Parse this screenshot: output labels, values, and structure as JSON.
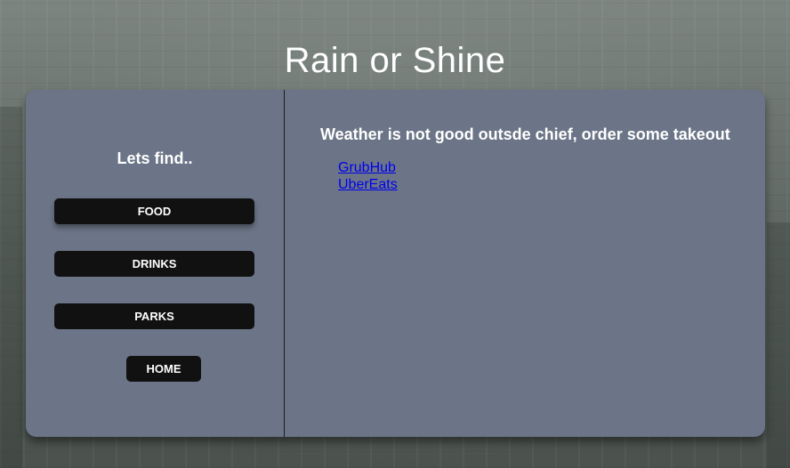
{
  "header": {
    "title": "Rain or Shine"
  },
  "sidebar": {
    "heading": "Lets find..",
    "buttons": {
      "food": "FOOD",
      "drinks": "DRINKS",
      "parks": "PARKS",
      "home": "HOME"
    }
  },
  "main": {
    "message": "Weather is not good outsde chief, order some takeout",
    "links": [
      {
        "label": "GrubHub"
      },
      {
        "label": "UberEats"
      }
    ]
  },
  "colors": {
    "panel": "#6b7587",
    "button": "#111111",
    "link": "#0000ee"
  }
}
